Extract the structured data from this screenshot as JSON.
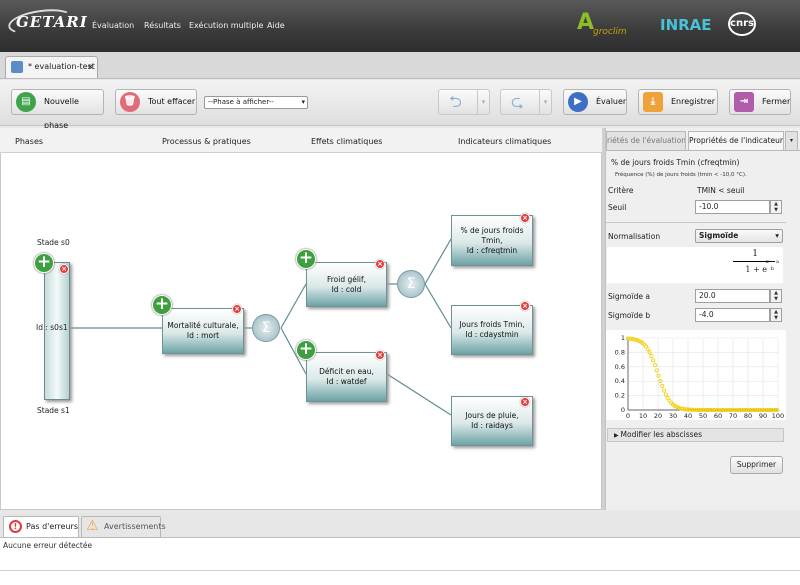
{
  "app": {
    "logo_text": "GETARI"
  },
  "menu": [
    "Évaluation",
    "Résultats",
    "Exécution multiple",
    "Aide"
  ],
  "brands": {
    "agroclim_letter": "A",
    "agroclim_word": "groclim",
    "inrae": "INRAE",
    "cnrs": "cnrs"
  },
  "tab": {
    "label": "* evaluation-test",
    "close": "×"
  },
  "toolbar": {
    "new_phase": "Nouvelle phase",
    "clear_all": "Tout effacer",
    "phase_select": "--Phase à afficher--",
    "evaluate": "Évaluer",
    "save": "Enregistrer",
    "close": "Fermer"
  },
  "columns": [
    "Phases",
    "Processus & pratiques",
    "Effets climatiques",
    "Indicateurs climatiques"
  ],
  "stages": {
    "top": "Stade s0",
    "id": "Id : s0s1",
    "bottom": "Stade s1"
  },
  "nodes": {
    "mort": [
      "Mortalité culturale,",
      "Id : mort"
    ],
    "cold": [
      "Froid gélif,",
      "Id : cold"
    ],
    "watdef": [
      "Déficit en eau,",
      "Id : watdef"
    ],
    "cfreqtmin": [
      "% de jours froids",
      "Tmin,",
      "Id : cfreqtmin"
    ],
    "cdaystmin": [
      "Jours froids Tmin,",
      "Id : cdaystmin"
    ],
    "raidays": [
      "Jours de pluie,",
      "Id : raidays"
    ]
  },
  "right_panel": {
    "tab1": "riétés de l'évaluation",
    "tab2": "Propriétés de l'indicateur",
    "indicator_name": "% de jours froids Tmin (cfreqtmin)",
    "indicator_desc": "Fréquence (%) de jours froids (tmin < -10,0 °C).",
    "criterion_label": "Critère",
    "criterion_value": "TMIN < seuil",
    "threshold_label": "Seuil",
    "threshold_value": "-10.0",
    "normalization_label": "Normalisation",
    "normalization_value": "Sigmoïde",
    "sig_a_label": "Sigmoïde a",
    "sig_a_value": "20.0",
    "sig_b_label": "Sigmoïde b",
    "sig_b_value": "-4.0",
    "formula_num": "1",
    "formula_den": "1 + e",
    "formula_exp": "x − a",
    "formula_exp_den": "b",
    "abscissa_toggle": "Modifier les abscisses",
    "delete_button": "Supprimer"
  },
  "chart_data": {
    "type": "scatter",
    "x_ticks": [
      "0",
      "10",
      "20",
      "30",
      "40",
      "50",
      "60",
      "70",
      "80",
      "90",
      "100"
    ],
    "y_ticks": [
      "0",
      "0.2",
      "0.4",
      "0.6",
      "0.8",
      "1"
    ],
    "xlim": [
      0,
      100
    ],
    "ylim": [
      0,
      1
    ],
    "function": "1/(1+exp((x-20)/-4))",
    "series_color": "#f2d21b"
  },
  "bottom": {
    "tab_errors": "Pas d'erreurs",
    "tab_warnings": "Avertissements",
    "status": "Aucune erreur détectée"
  }
}
